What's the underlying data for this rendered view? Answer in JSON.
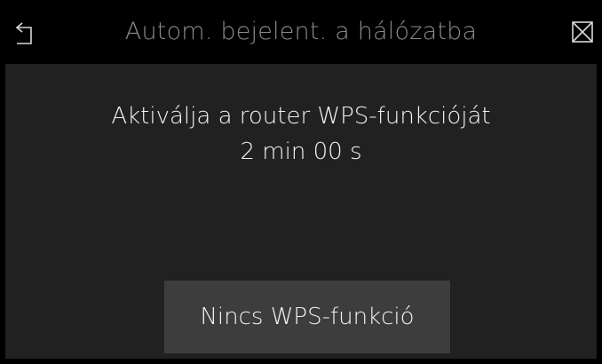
{
  "header": {
    "title": "Autom. bejelent. a hálózatba",
    "back_icon": "back-arrow-icon",
    "close_icon": "close-icon"
  },
  "content": {
    "message": "Aktiválja a router WPS-funkcióját",
    "countdown": "2 min 00 s"
  },
  "actions": {
    "no_wps_label": "Nincs WPS-funkció"
  },
  "colors": {
    "background": "#000000",
    "panel": "#212121",
    "button": "#3d3d3d",
    "title": "#8a8a8a",
    "text": "#f2f2f2"
  }
}
